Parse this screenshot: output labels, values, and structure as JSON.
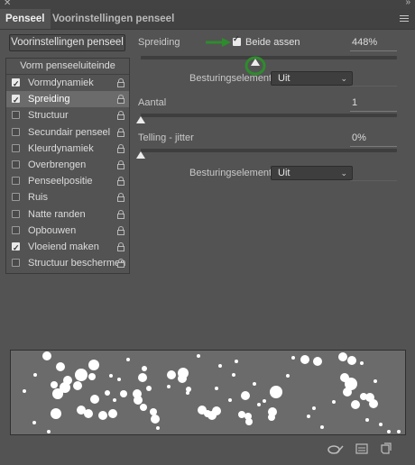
{
  "window": {
    "close_glyph": "✕",
    "collapse_glyph": "»"
  },
  "tabs": [
    {
      "label": "Penseel",
      "active": true
    },
    {
      "label": "Voorinstellingen penseel",
      "active": false
    }
  ],
  "left": {
    "presets_button": "Voorinstellingen penseel",
    "section_header": "Vorm penseeluiteinde",
    "items": [
      {
        "label": "Vormdynamiek",
        "checked": true,
        "selected": false
      },
      {
        "label": "Spreiding",
        "checked": true,
        "selected": true
      },
      {
        "label": "Structuur",
        "checked": false,
        "selected": false
      },
      {
        "label": "Secundair penseel",
        "checked": false,
        "selected": false
      },
      {
        "label": "Kleurdynamiek",
        "checked": false,
        "selected": false
      },
      {
        "label": "Overbrengen",
        "checked": false,
        "selected": false
      },
      {
        "label": "Penseelpositie",
        "checked": false,
        "selected": false
      },
      {
        "label": "Ruis",
        "checked": false,
        "selected": false
      },
      {
        "label": "Natte randen",
        "checked": false,
        "selected": false
      },
      {
        "label": "Opbouwen",
        "checked": false,
        "selected": false
      },
      {
        "label": "Vloeiend maken",
        "checked": true,
        "selected": false
      },
      {
        "label": "Structuur beschermen",
        "checked": false,
        "selected": false
      }
    ]
  },
  "right": {
    "scatter": {
      "label": "Spreiding",
      "both_axes_label": "Beide assen",
      "both_axes_checked": true,
      "value": "448%",
      "level_fraction": 0.448
    },
    "control1": {
      "label": "Besturingselement:",
      "value": "Uit"
    },
    "count": {
      "label": "Aantal",
      "value": "1",
      "level_fraction": 0.0
    },
    "count_jitter": {
      "label": "Telling - jitter",
      "value": "0%",
      "level_fraction": 0.0
    },
    "control2": {
      "label": "Besturingselement:",
      "value": "Uit"
    }
  },
  "annotation": {
    "color": "#2e8b2e"
  },
  "colors": {
    "panel": "#535353",
    "selected_row": "#6b6b6b",
    "preview_bg": "#6b6b6b"
  }
}
